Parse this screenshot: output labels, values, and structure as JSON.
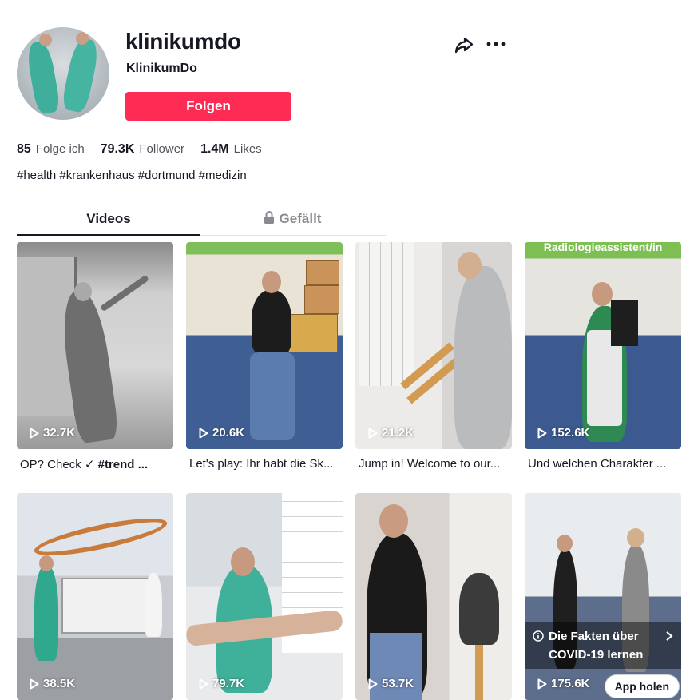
{
  "profile": {
    "username": "klinikumdo",
    "nickname": "KlinikumDo",
    "follow_label": "Folgen",
    "bio": "#health #krankenhaus #dortmund #medizin"
  },
  "stats": [
    {
      "value": "85",
      "label": "Folge ich"
    },
    {
      "value": "79.3K",
      "label": "Follower"
    },
    {
      "value": "1.4M",
      "label": "Likes"
    }
  ],
  "tabs": {
    "videos": "Videos",
    "liked": "Gefällt"
  },
  "videos": [
    {
      "views": "32.7K",
      "caption": "OP? Check ✓ ",
      "caption_tag": "#trend ..."
    },
    {
      "views": "20.6K",
      "caption": "Let's play: Ihr habt die Sk..."
    },
    {
      "views": "21.2K",
      "caption": "Jump in! Welcome to our..."
    },
    {
      "views": "152.6K",
      "caption": "Und welchen Charakter ...",
      "banner": "Radiologieassistent/in"
    },
    {
      "views": "38.5K"
    },
    {
      "views": "79.7K"
    },
    {
      "views": "53.7K"
    },
    {
      "views": "175.6K",
      "info_banner": "Die Fakten über COVID-19 lernen",
      "app_button": "App holen"
    }
  ],
  "colors": {
    "follow_button": "#fe2c55",
    "text": "#161823",
    "banner_green": "#7dbf53"
  },
  "icons": [
    "share-icon",
    "more-icon",
    "lock-icon",
    "play-icon",
    "info-icon",
    "chevron-right-icon"
  ]
}
